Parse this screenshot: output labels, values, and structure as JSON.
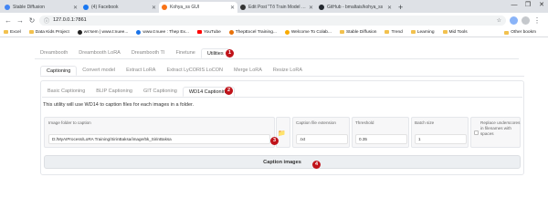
{
  "browser": {
    "tabs": [
      {
        "label": "Stable Diffusion",
        "color": "#4285f4",
        "active": false
      },
      {
        "label": "(4) Facebook",
        "color": "#1877f2",
        "active": false
      },
      {
        "label": "Kohya_ss GUI",
        "color": "#f97316",
        "active": true
      },
      {
        "label": "Edit Post \"Tổ Train Model cuối cùng",
        "color": "#333333",
        "active": false
      },
      {
        "label": "GitHub - bmaltais/kohya_ss",
        "color": "#24292f",
        "active": false
      }
    ],
    "new_tab": "+",
    "window_controls": [
      "—",
      "❐",
      "✕"
    ],
    "url": "127.0.0.1:7861",
    "bookmarks": [
      {
        "label": "Excel",
        "icon": "folder-icon"
      },
      {
        "label": "Data Kids Project",
        "icon": "folder-icon"
      },
      {
        "label": "ws'sem | www.t:nuee...",
        "icon": "site-icon"
      },
      {
        "label": "www.t:nuee : Thep Ex...",
        "icon": "site-icon"
      },
      {
        "label": "YouTube",
        "icon": "youtube-icon"
      },
      {
        "label": "ThepExcel Training...",
        "icon": "site-icon"
      },
      {
        "label": "Welcome To Colab...",
        "icon": "colab-icon"
      },
      {
        "label": "Stable Diffusion",
        "icon": "folder-icon"
      },
      {
        "label": "Trend",
        "icon": "folder-icon"
      },
      {
        "label": "Learning",
        "icon": "folder-icon"
      },
      {
        "label": "Mid Tools",
        "icon": "folder-icon"
      }
    ],
    "other_bookmarks": "Other bookm"
  },
  "main_tabs": [
    "Dreambooth",
    "Dreambooth LoRA",
    "Dreambooth TI",
    "Finetune",
    "Utilities"
  ],
  "sub_tabs": [
    "Captioning",
    "Convert model",
    "Extract LoRA",
    "Extract LyCORIS LoCON",
    "Merge LoRA",
    "Resize LoRA"
  ],
  "caption_tabs": [
    "Basic Captioning",
    "BLIP Captioning",
    "GIT Captioning",
    "WD14 Captioning"
  ],
  "description": "This utility will use WD14 to caption files for each images in a folder.",
  "form": {
    "folder_label": "Image folder to caption",
    "folder_value": "D:/MyAIProcess/LoRA Training/SirinBaksa/image/5k_SirinBaksa",
    "ext_label": "Caption file extension",
    "ext_value": ".txt",
    "threshold_label": "Threshold",
    "threshold_value": "0.35",
    "batch_label": "Batch size",
    "batch_value": "1",
    "underscore_label": "Replace underscores in filenames with spaces"
  },
  "caption_button": "Caption images",
  "markers": [
    "1",
    "2",
    "3",
    "4"
  ]
}
